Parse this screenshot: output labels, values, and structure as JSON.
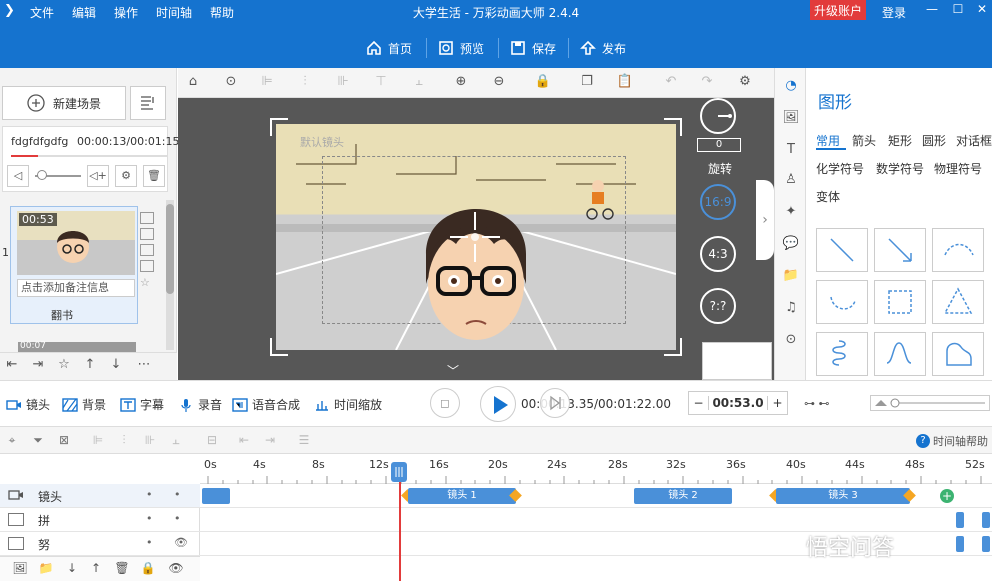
{
  "menu": [
    "文件",
    "编辑",
    "操作",
    "时间轴",
    "帮助"
  ],
  "app_title": "大学生活 - 万彩动画大师 2.4.4",
  "upgrade_label": "升级账户",
  "login_label": "登录",
  "toolbar": {
    "home": "首页",
    "preview": "预览",
    "save": "保存",
    "publish": "发布"
  },
  "left": {
    "new_scene": "新建场景",
    "scene_name": "fdgfdfgdfg",
    "scene_time": "00:00:13/00:01:15",
    "scene_progress": 0.17,
    "thumb_duration": "00:53",
    "scene_index": "1",
    "scene_note": "点击添加备注信息",
    "scene_label": "翻书",
    "next_thumb": "00:07"
  },
  "canvas": {
    "camera_label": "默认镜头",
    "rotation_value": "0",
    "rotation_label": "旋转",
    "ratio_169": "16:9",
    "ratio_43": "4:3",
    "ratio_custom": "?:?"
  },
  "panel": {
    "title": "图形",
    "categories": [
      "常用",
      "箭头",
      "矩形",
      "圆形",
      "对话框",
      "化学符号",
      "数学符号",
      "物理符号",
      "变体"
    ]
  },
  "timeline": {
    "camera": "镜头",
    "background": "背景",
    "caption": "字幕",
    "record": "录音",
    "tts": "语音合成",
    "time_zoom": "时间缩放",
    "time_display": "00:00:13.35/00:01:22.00",
    "duration": "00:53.0",
    "help": "时间轴帮助",
    "ruler": [
      "0s",
      "4s",
      "8s",
      "12s",
      "16s",
      "20s",
      "24s",
      "28s",
      "32s",
      "36s",
      "40s",
      "44s",
      "48s",
      "52s"
    ],
    "tracks": [
      {
        "name": "镜头"
      },
      {
        "name": "拼"
      },
      {
        "name": "努"
      }
    ],
    "blocks": [
      "镜头 1",
      "镜头 2",
      "镜头 3"
    ]
  },
  "watermark": "悟空问答",
  "colors": {
    "primary": "#1573cf",
    "accent": "#e23b3b",
    "block": "#4a90d9"
  }
}
